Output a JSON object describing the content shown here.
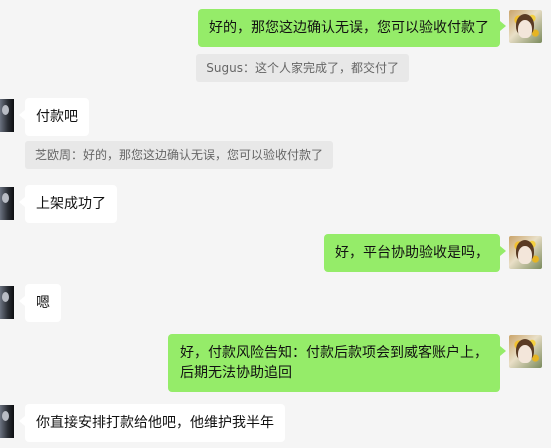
{
  "messages": [
    {
      "side": "out",
      "text": "好的，那您这边确认无误，您可以验收付款了"
    },
    {
      "quote": "Sugus：这个人家完成了，都交付了"
    },
    {
      "side": "in",
      "text": "付款吧"
    },
    {
      "quote": "芝欧周：好的，那您这边确认无误，您可以验收付款了"
    },
    {
      "side": "in",
      "text": "上架成功了"
    },
    {
      "side": "out",
      "text": "好，平台协助验收是吗，"
    },
    {
      "side": "in",
      "text": "嗯"
    },
    {
      "side": "out",
      "line1": "好，付款风险告知：付款后款项会到威客账户上，",
      "line2": "后期无法协助追回"
    },
    {
      "side": "in",
      "text": "你直接安排打款给他吧，他维护我半年"
    }
  ],
  "colors": {
    "outgoing_bubble": "#95ec69",
    "incoming_bubble": "#ffffff",
    "background": "#f5f5f5",
    "quote_bg": "#e8e8e8"
  },
  "icons": {
    "my_avatar": "avatar-photo-flowers",
    "other_avatar": "avatar-photo-person"
  }
}
